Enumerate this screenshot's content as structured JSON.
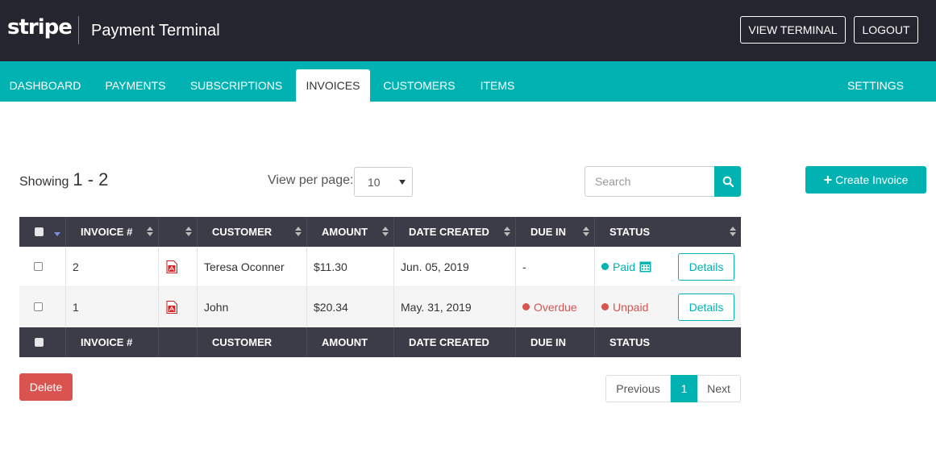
{
  "header": {
    "logo": "stripe",
    "title": "Payment Terminal",
    "view_terminal_label": "VIEW TERMINAL",
    "logout_label": "LOGOUT"
  },
  "nav": {
    "items": [
      "DASHBOARD",
      "PAYMENTS",
      "SUBSCRIPTIONS",
      "INVOICES",
      "CUSTOMERS",
      "ITEMS"
    ],
    "settings": "SETTINGS",
    "active": "INVOICES"
  },
  "toolbar": {
    "showing_label": "Showing",
    "showing_range": "1 - 2",
    "view_per_page_label": "View per page:",
    "view_per_page_value": "10",
    "search_placeholder": "Search",
    "create_label": "Create Invoice"
  },
  "table": {
    "columns": [
      "INVOICE #",
      "CUSTOMER",
      "AMOUNT",
      "DATE CREATED",
      "DUE IN",
      "STATUS"
    ],
    "rows": [
      {
        "invoice": "2",
        "customer": "Teresa Oconner",
        "amount": "$11.30",
        "date": "Jun. 05, 2019",
        "due": "-",
        "status": "Paid",
        "details": "Details"
      },
      {
        "invoice": "1",
        "customer": "John",
        "amount": "$20.34",
        "date": "May. 31, 2019",
        "due": "Overdue",
        "status": "Unpaid",
        "details": "Details"
      }
    ]
  },
  "footer": {
    "delete_label": "Delete",
    "prev_label": "Previous",
    "current_page": "1",
    "next_label": "Next"
  },
  "colors": {
    "accent": "#01b2b2",
    "header_bg": "#25252f",
    "table_head_bg": "#3c3b48",
    "danger": "#d9534f"
  }
}
